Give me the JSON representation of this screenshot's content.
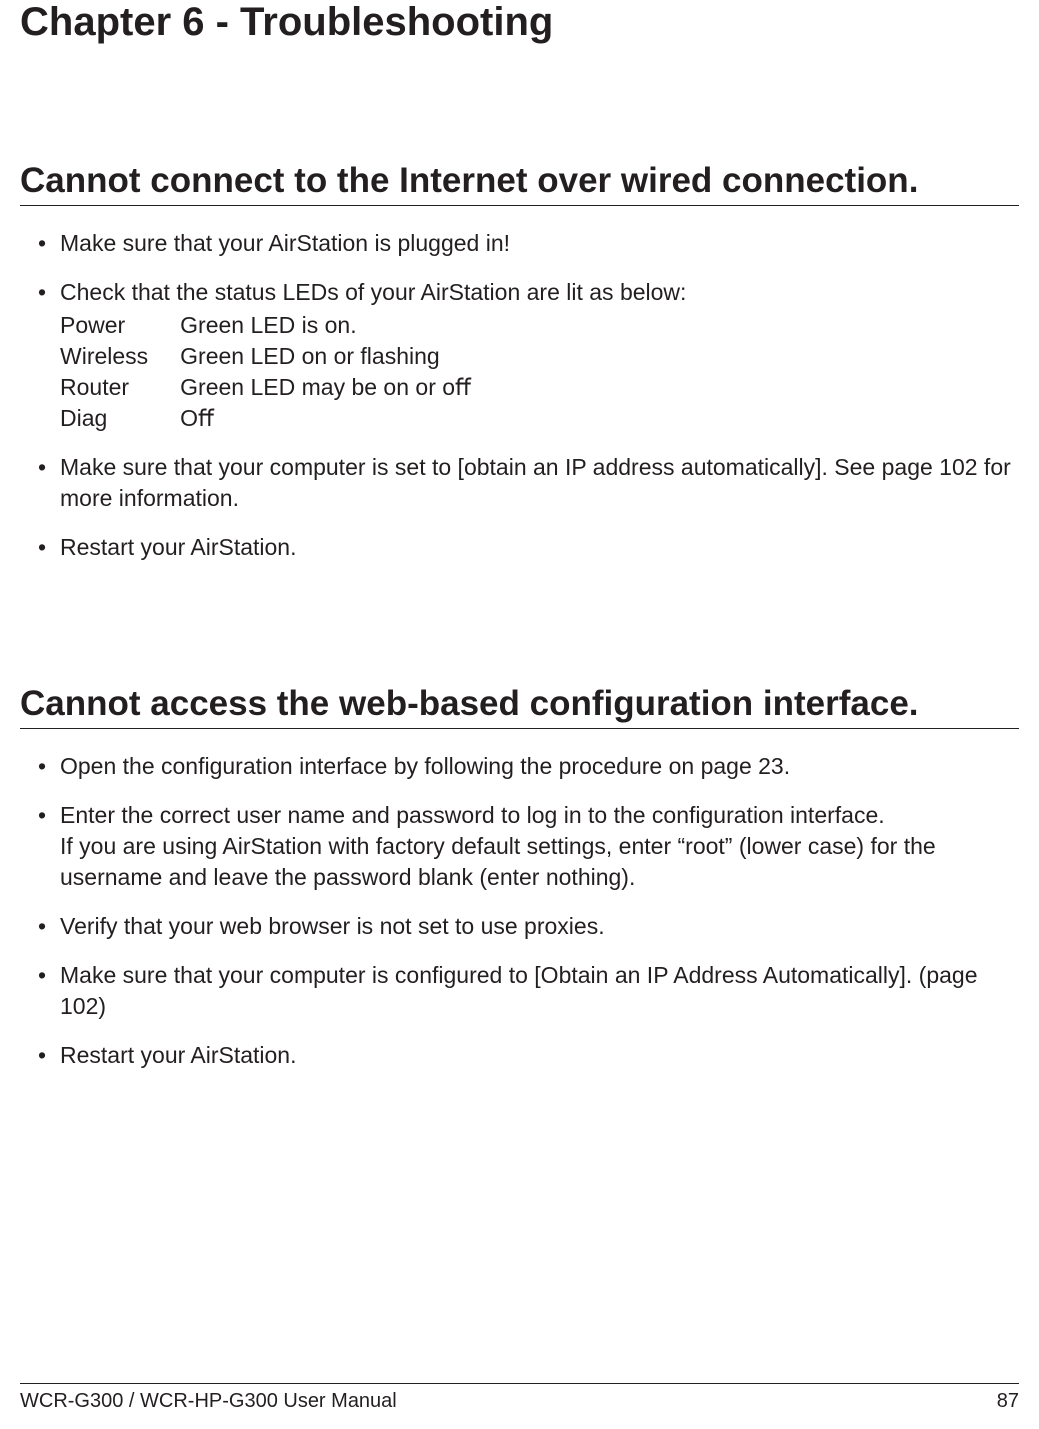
{
  "chapter_title": "Chapter 6 - Troubleshooting",
  "section1": {
    "title": "Cannot connect to the Internet over wired connection.",
    "b1": "Make sure that your AirStation is plugged in!",
    "b2": "Check that the status LEDs of your AirStation are lit as below:",
    "leds": {
      "r1": {
        "label": "Power",
        "value": "Green LED is on."
      },
      "r2": {
        "label": "Wireless",
        "value": "Green LED on or ﬂashing"
      },
      "r3": {
        "label": "Router",
        "value": "Green LED may be on or oﬀ"
      },
      "r4": {
        "label": "Diag",
        "value": "Oﬀ"
      }
    },
    "b3": "Make sure that your computer is set to [obtain an IP address automatically]. See page 102 for more information.",
    "b4": "Restart your AirStation."
  },
  "section2": {
    "title": "Cannot access the web-based conﬁguration interface.",
    "b1": "Open the conﬁguration interface by following the procedure on page 23.",
    "b2": "Enter the correct user name and password to log in to the conﬁguration interface.\nIf you are using AirStation with factory default settings, enter “root” (lower case) for the username and leave the password blank (enter nothing).",
    "b3": "Verify that your web browser is not set to use proxies.",
    "b4": "Make sure that your computer is conﬁgured to [Obtain an IP Address Automatically]. (page 102)",
    "b5": "Restart your AirStation."
  },
  "footer": {
    "manual": "WCR-G300 / WCR-HP-G300 User Manual",
    "page": "87"
  }
}
